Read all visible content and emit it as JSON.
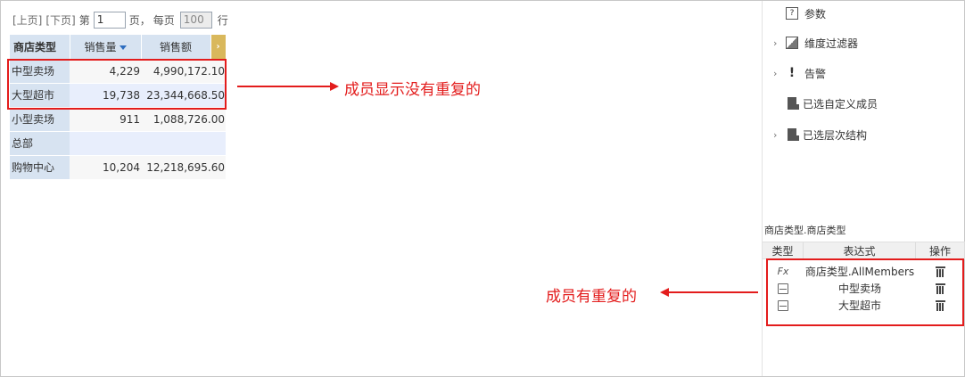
{
  "pager": {
    "prev": "[上页]",
    "next": "[下页]",
    "page_prefix": "第",
    "page_value": "1",
    "page_suffix": "页，",
    "per_page_prefix": "每页",
    "per_page_value": "100",
    "per_page_suffix": "行"
  },
  "grid": {
    "headers": {
      "dimension": "商店类型",
      "sales_qty": "销售量",
      "sales_amount": "销售额"
    },
    "rows": [
      {
        "name": "中型卖场",
        "qty": "4,229",
        "amount": "4,990,172.10"
      },
      {
        "name": "大型超市",
        "qty": "19,738",
        "amount": "23,344,668.50"
      },
      {
        "name": "小型卖场",
        "qty": "911",
        "amount": "1,088,726.00"
      },
      {
        "name": "总部",
        "qty": "",
        "amount": ""
      },
      {
        "name": "购物中心",
        "qty": "10,204",
        "amount": "12,218,695.60"
      }
    ]
  },
  "annotations": {
    "left": "成员显示没有重复的",
    "right": "成员有重复的"
  },
  "panel": {
    "tree": [
      {
        "label": "参数",
        "icon": "param-icon",
        "expandable": false
      },
      {
        "label": "维度过滤器",
        "icon": "filter-icon",
        "expandable": true
      },
      {
        "label": "告警",
        "icon": "alert-icon",
        "expandable": true
      },
      {
        "label": "已选自定义成员",
        "icon": "member-icon",
        "expandable": false
      },
      {
        "label": "已选层次结构",
        "icon": "hierarchy-icon",
        "expandable": true
      }
    ],
    "dimension_title": "商店类型.商店类型",
    "member_table": {
      "headers": {
        "type": "类型",
        "expression": "表达式",
        "action": "操作"
      },
      "rows": [
        {
          "type_icon": "fx-icon",
          "type_text": "Fx",
          "expression": "商店类型.AllMembers"
        },
        {
          "type_icon": "cube-icon",
          "type_text": "",
          "expression": "中型卖场"
        },
        {
          "type_icon": "cube-icon",
          "type_text": "",
          "expression": "大型超市"
        }
      ]
    }
  },
  "colors": {
    "highlight": "#e31c1c",
    "header_bg": "#d7e3f1",
    "menu_btn": "#d9b85c"
  }
}
